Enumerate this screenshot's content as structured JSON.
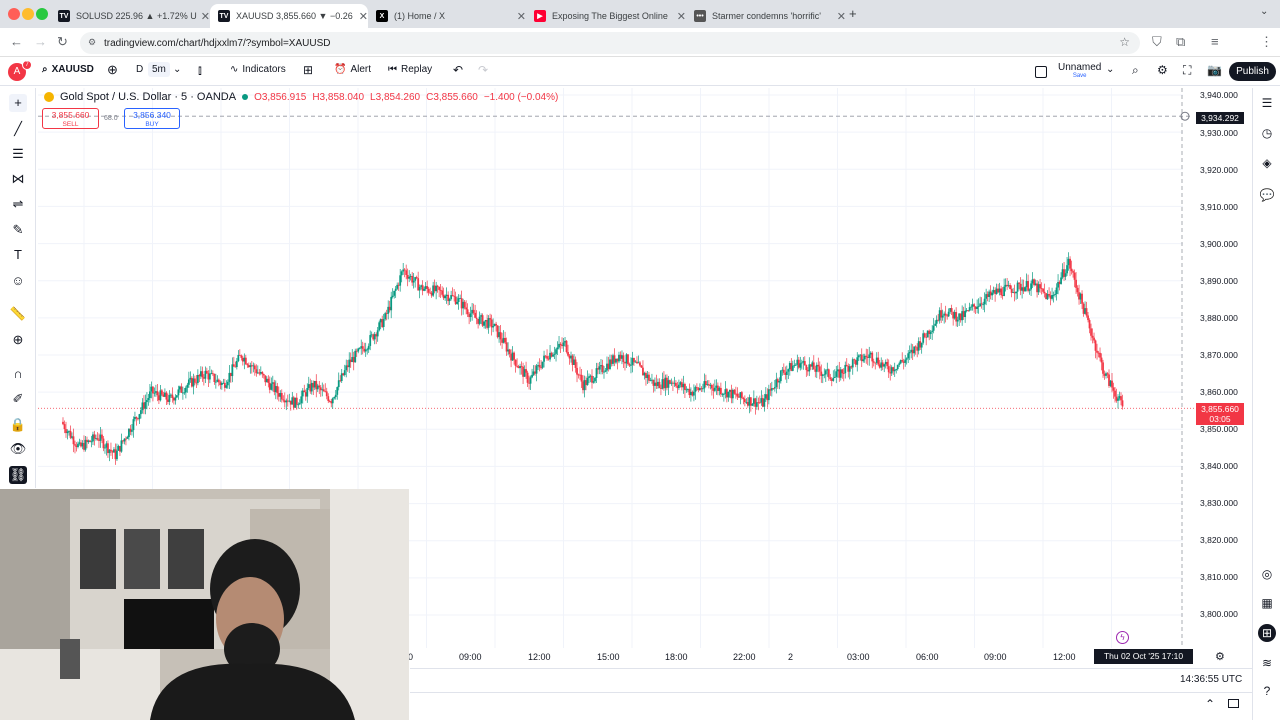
{
  "browser": {
    "tabs": [
      {
        "title": "SOLUSD 225.96 ▲ +1.72% U",
        "icon": "tradingview-icon",
        "active": false
      },
      {
        "title": "XAUUSD 3,855.660 ▼ −0.26",
        "icon": "tradingview-icon",
        "active": true
      },
      {
        "title": "(1) Home / X",
        "icon": "x-icon",
        "active": false
      },
      {
        "title": "Exposing The Biggest Online",
        "icon": "youtube-icon",
        "active": false
      },
      {
        "title": "Starmer condemns 'horrific' ",
        "icon": "news-icon",
        "active": false
      }
    ],
    "url": "tradingview.com/chart/hdjxxlm7/?symbol=XAUUSD"
  },
  "toolbar": {
    "avatar_letter": "A",
    "avatar_badge": "7",
    "symbol": "XAUUSD",
    "interval_d": "D",
    "interval": "5m",
    "indicators": "Indicators",
    "alert": "Alert",
    "replay": "Replay",
    "layout_name": "Unnamed",
    "layout_status": "Save",
    "publish": "Publish"
  },
  "legend": {
    "title": "Gold Spot / U.S. Dollar · 5 · OANDA",
    "o": "O3,856.915",
    "h": "H3,858.040",
    "l": "L3,854.260",
    "c": "C3,855.660",
    "change": "−1.400 (−0.04%)",
    "sell_price": "3,855.660",
    "sell_label": "SELL",
    "spread": "68.0",
    "buy_price": "3,856.340",
    "buy_label": "BUY"
  },
  "price_axis": [
    "3,940.000",
    "3,930.000",
    "3,920.000",
    "3,910.000",
    "3,900.000",
    "3,890.000",
    "3,880.000",
    "3,870.000",
    "3,860.000",
    "3,850.000",
    "3,840.000",
    "3,830.000",
    "3,820.000",
    "3,810.000",
    "3,800.000"
  ],
  "time_axis": [
    "0",
    "09:00",
    "12:00",
    "15:00",
    "18:00",
    "22:00",
    "2",
    "03:00",
    "06:00",
    "09:00",
    "12:00"
  ],
  "crosshair_price": "3,934.292",
  "last_price": "3,855.660",
  "countdown": "03:05",
  "crosshair_date": "Thu 02 Oct '25   17:10",
  "clock": "14:36:55 UTC",
  "colors": {
    "up": "#089981",
    "down": "#f23645",
    "accent": "#2962ff"
  },
  "chart_data": {
    "type": "candlestick",
    "symbol": "XAUUSD",
    "interval": "5",
    "ylim": [
      3800,
      3940
    ],
    "x": [
      "0",
      "09:00",
      "12:00",
      "15:00",
      "18:00",
      "22:00",
      "2",
      "03:00",
      "06:00",
      "09:00",
      "12:00"
    ],
    "close_path": [
      3852,
      3845,
      3848,
      3843,
      3852,
      3860,
      3858,
      3862,
      3865,
      3862,
      3870,
      3865,
      3860,
      3857,
      3862,
      3858,
      3868,
      3873,
      3880,
      3893,
      3888,
      3887,
      3885,
      3880,
      3878,
      3870,
      3863,
      3870,
      3873,
      3862,
      3866,
      3870,
      3867,
      3862,
      3863,
      3860,
      3862,
      3860,
      3858,
      3857,
      3865,
      3868,
      3866,
      3864,
      3868,
      3870,
      3866,
      3869,
      3875,
      3882,
      3880,
      3884,
      3887,
      3888,
      3889,
      3885,
      3895,
      3880,
      3865,
      3856
    ]
  }
}
